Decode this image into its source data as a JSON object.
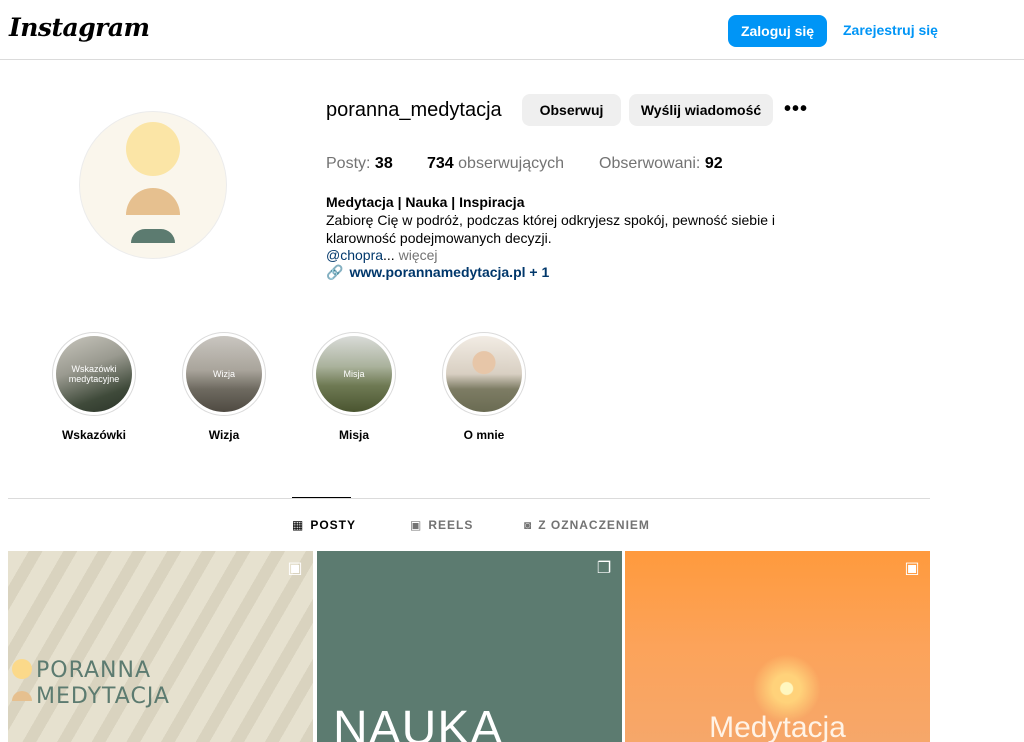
{
  "topbar": {
    "logo": "Instagram",
    "login_label": "Zaloguj się",
    "signup_label": "Zarejestruj się"
  },
  "profile": {
    "username": "poranna_medytacja",
    "follow_label": "Obserwuj",
    "message_label": "Wyślij wiadomość",
    "more_label": "•••",
    "stats": {
      "posts_label": "Posty:",
      "posts_value": "38",
      "followers_value": "734",
      "followers_label": "obserwujących",
      "following_label": "Obserwowani:",
      "following_value": "92"
    },
    "bio": {
      "name": "Medytacja | Nauka | Inspiracja",
      "text": "Zabiorę Cię w podróż, podczas której odkryjesz spokój, pewność siebie i klarowność podejmowanych decyzji.",
      "mention": "@chopra",
      "ellipsis": "...",
      "more": "więcej",
      "link": "www.porannamedytacja.pl + 1"
    }
  },
  "highlights": [
    {
      "label": "Wskazówki",
      "cover_text": "Wskazówki medytacyjne"
    },
    {
      "label": "Wizja",
      "cover_text": "Wizja"
    },
    {
      "label": "Misja",
      "cover_text": "Misja"
    },
    {
      "label": "O mnie",
      "cover_text": ""
    }
  ],
  "tabs": [
    {
      "label": "POSTY",
      "icon": "grid-icon",
      "glyph": "▦"
    },
    {
      "label": "REELS",
      "icon": "reels-icon",
      "glyph": "▣"
    },
    {
      "label": "Z OZNACZENIEM",
      "icon": "tagged-icon",
      "glyph": "◙"
    }
  ],
  "posts": [
    {
      "line1": "PORANNA",
      "line2": "MEDYTACJA",
      "badge": "reels-icon",
      "badge_glyph": "▣"
    },
    {
      "text": "NAUKA",
      "badge": "carousel-icon",
      "badge_glyph": "❐"
    },
    {
      "text": "Medytacja",
      "badge": "reels-icon",
      "badge_glyph": "▣"
    }
  ],
  "colors": {
    "accent": "#0095f6",
    "brand_green": "#5c7b70",
    "link": "#00376b"
  }
}
